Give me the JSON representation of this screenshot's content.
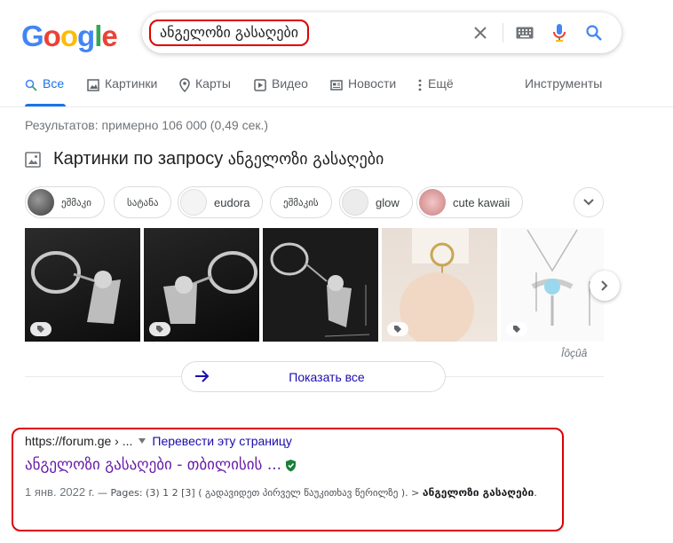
{
  "logo": {
    "letters": [
      "G",
      "o",
      "o",
      "g",
      "l",
      "e"
    ],
    "colors": [
      "#4285F4",
      "#EA4335",
      "#FBBC05",
      "#4285F4",
      "#34A853",
      "#EA4335"
    ]
  },
  "search": {
    "query": "ანგელოზი გასაღები"
  },
  "tabs": [
    {
      "label": "Все",
      "icon": "search-icon"
    },
    {
      "label": "Картинки",
      "icon": "image-icon"
    },
    {
      "label": "Карты",
      "icon": "map-pin-icon"
    },
    {
      "label": "Видео",
      "icon": "video-icon"
    },
    {
      "label": "Новости",
      "icon": "news-icon"
    },
    {
      "label": "Ещё",
      "icon": "more-vert-icon"
    }
  ],
  "tools_label": "Инструменты",
  "stats": "Результатов: примерно 106 000 (0,49 сек.)",
  "images_section": {
    "heading_prefix": "Картинки по запросу",
    "heading_query": "ანგელოზი გასაღები",
    "chips": [
      {
        "label": "ეშმაკი",
        "has_thumb": true,
        "thumb": "#5a5a5a"
      },
      {
        "label": "სატანა",
        "has_thumb": false
      },
      {
        "label": "eudora",
        "has_thumb": true,
        "thumb": "#f1f1f1"
      },
      {
        "label": "ეშმაკის",
        "has_thumb": false
      },
      {
        "label": "glow",
        "has_thumb": true,
        "thumb": "#e9e9e9"
      },
      {
        "label": "cute kawaii",
        "has_thumb": true,
        "thumb": "#e8b4b4"
      }
    ],
    "show_all": "Показать все",
    "caption": "Îôçûâ"
  },
  "result": {
    "url": "https://forum.ge › ...",
    "translate": "Перевести эту страницу",
    "title": "ანგელოზი გასაღები - თბილისის ...",
    "snippet_date": "1 янв. 2022 г.",
    "snippet_text": " — Pages: (3) 1 2 [3] ( გადავიდეთ პირველ წაუკითხავ წერილზე ). > ",
    "snippet_bold": "ანგელოზი გასაღები",
    "snippet_end": "."
  }
}
